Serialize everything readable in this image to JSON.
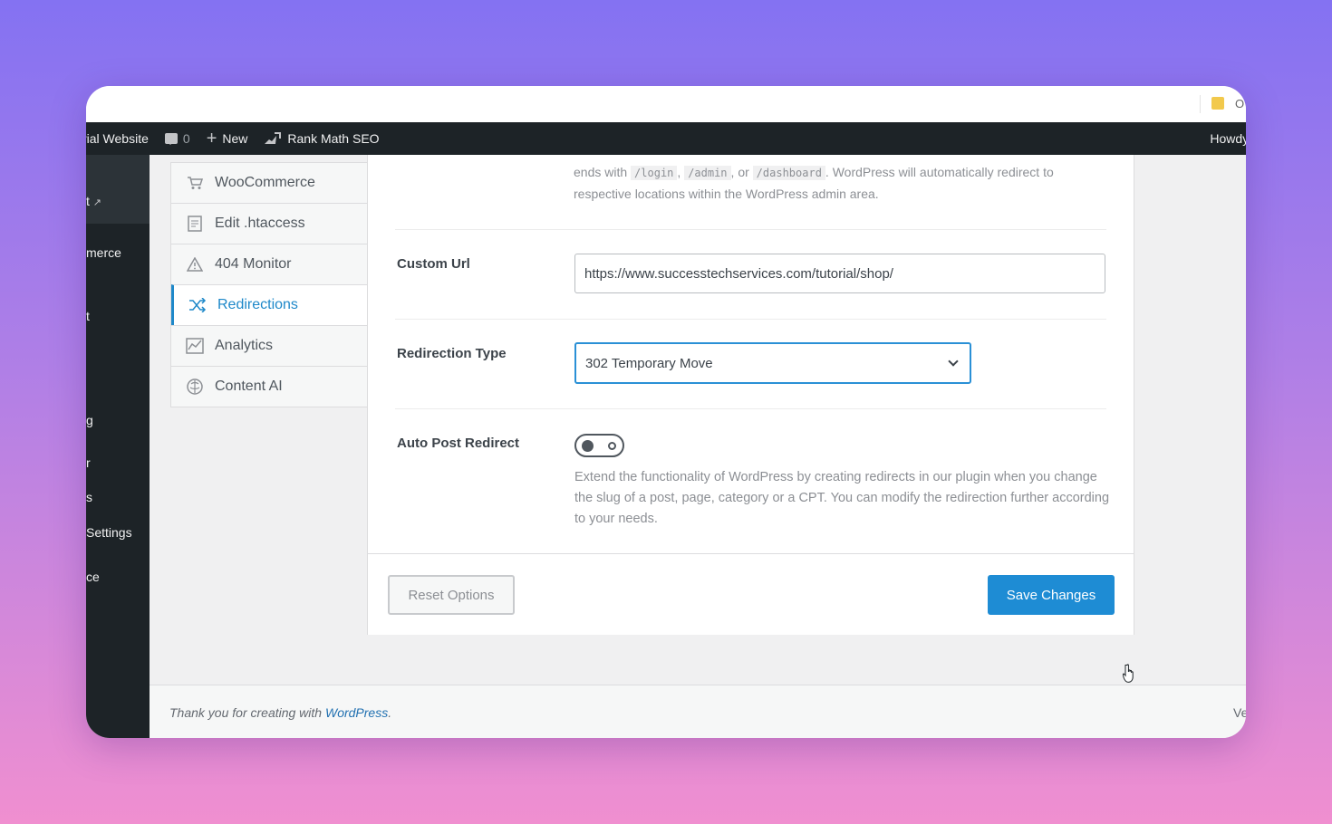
{
  "browser": {
    "extension_text": "O"
  },
  "admin_bar": {
    "site_name": "rial Website",
    "comments_count": "0",
    "new_label": "New",
    "plugin_label": "Rank Math SEO",
    "howdy": "Howdy,"
  },
  "left_nav": {
    "items": [
      "t",
      "merce",
      "t",
      "g",
      "r",
      "s",
      "Settings",
      "ce"
    ]
  },
  "tabs": [
    {
      "label": "WooCommerce",
      "icon": "cart-icon"
    },
    {
      "label": "Edit .htaccess",
      "icon": "file-icon"
    },
    {
      "label": "404 Monitor",
      "icon": "warning-icon"
    },
    {
      "label": "Redirections",
      "icon": "shuffle-icon",
      "active": true
    },
    {
      "label": "Analytics",
      "icon": "chart-icon"
    },
    {
      "label": "Content AI",
      "icon": "brain-icon"
    }
  ],
  "settings": {
    "top_description": {
      "pre": "ends with",
      "code1": "/login",
      "code2": "/admin",
      "code3": "/dashboard",
      "sep1": ",",
      "or": ", or",
      "post": ". WordPress will automatically redirect to respective locations within the WordPress admin area."
    },
    "custom_url": {
      "label": "Custom Url",
      "value": "https://www.successtechservices.com/tutorial/shop/"
    },
    "redirection_type": {
      "label": "Redirection Type",
      "value": "302 Temporary Move"
    },
    "auto_post_redirect": {
      "label": "Auto Post Redirect",
      "enabled": false,
      "description": "Extend the functionality of WordPress by creating redirects in our plugin when you change the slug of a post, page, category or a CPT. You can modify the redirection further according to your needs."
    },
    "reset_label": "Reset Options",
    "save_label": "Save Changes"
  },
  "footer": {
    "thanks_pre": "Thank you for creating with",
    "wordpress_link": "WordPress",
    "thanks_post": ".",
    "version_fragment": "Ve"
  },
  "colors": {
    "accent": "#1e8cd4",
    "admin_bar": "#1d2327"
  }
}
